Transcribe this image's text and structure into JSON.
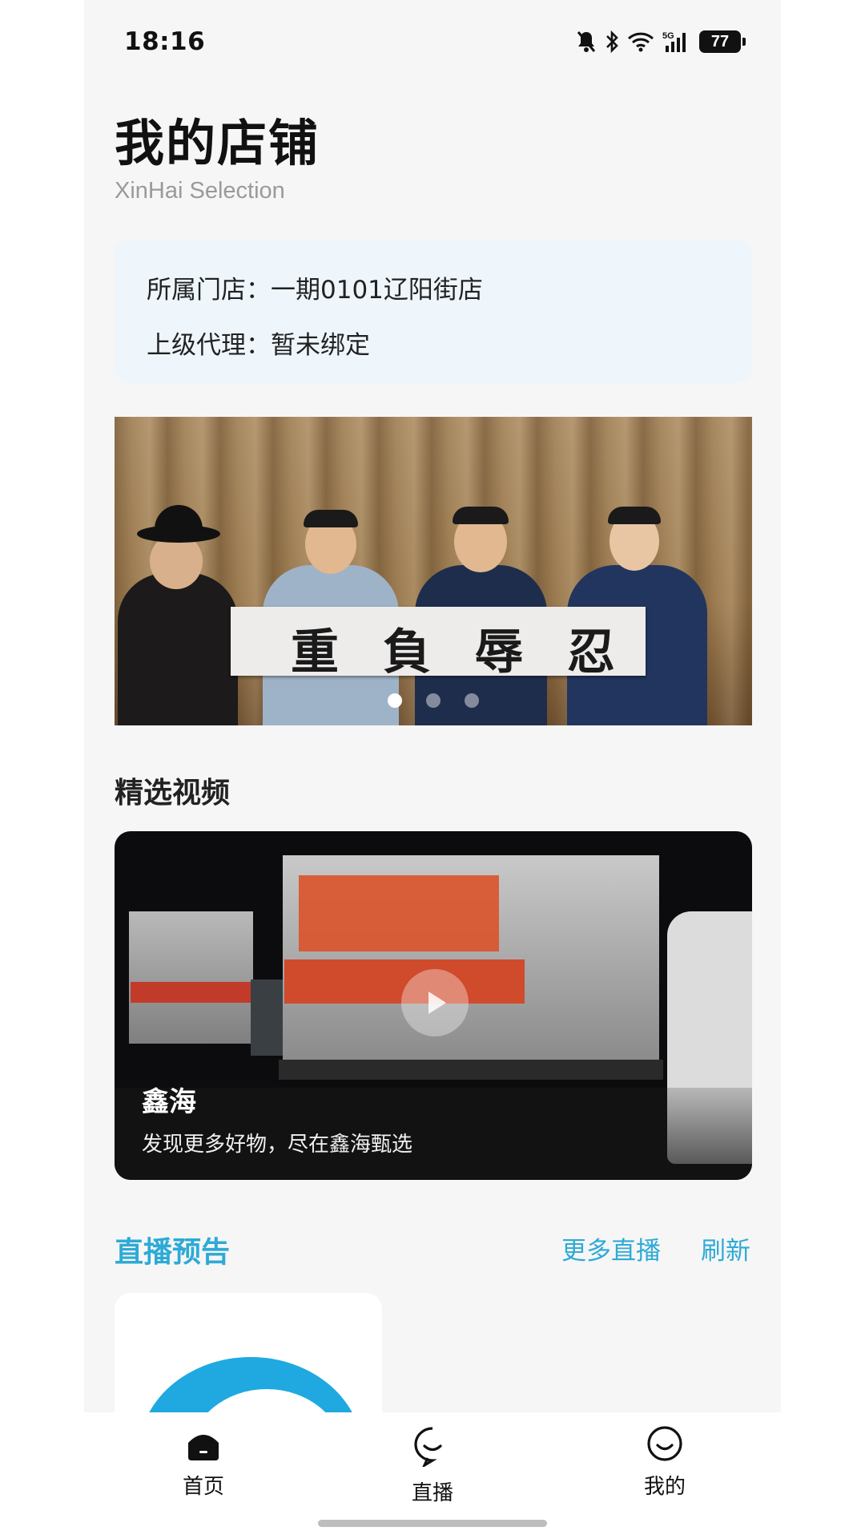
{
  "status_bar": {
    "time": "18:16",
    "battery": "77",
    "network": "5G"
  },
  "header": {
    "title": "我的店铺",
    "subtitle": "XinHai Selection"
  },
  "store_info": {
    "store_label": "所属门店：",
    "store_value": "一期0101辽阳街店",
    "agent_label": "上级代理：",
    "agent_value": "暂未绑定"
  },
  "banner": {
    "slides": 3,
    "active_index": 0,
    "calligraphy": [
      "忍",
      "辱",
      "負",
      "重"
    ]
  },
  "featured": {
    "section_title": "精选视频",
    "video_title": "鑫海",
    "video_desc": "发现更多好物，尽在鑫海甄选"
  },
  "live": {
    "section_title": "直播预告",
    "more_label": "更多直播",
    "refresh_label": "刷新"
  },
  "tabbar": [
    {
      "label": "首页",
      "icon": "home-icon",
      "active": true
    },
    {
      "label": "直播",
      "icon": "chat-bubble-icon",
      "active": false
    },
    {
      "label": "我的",
      "icon": "smiley-icon",
      "active": false
    }
  ],
  "colors": {
    "accent": "#2eaad6",
    "page_bg": "#f6f6f6",
    "info_card_bg": "#eef6fc"
  }
}
